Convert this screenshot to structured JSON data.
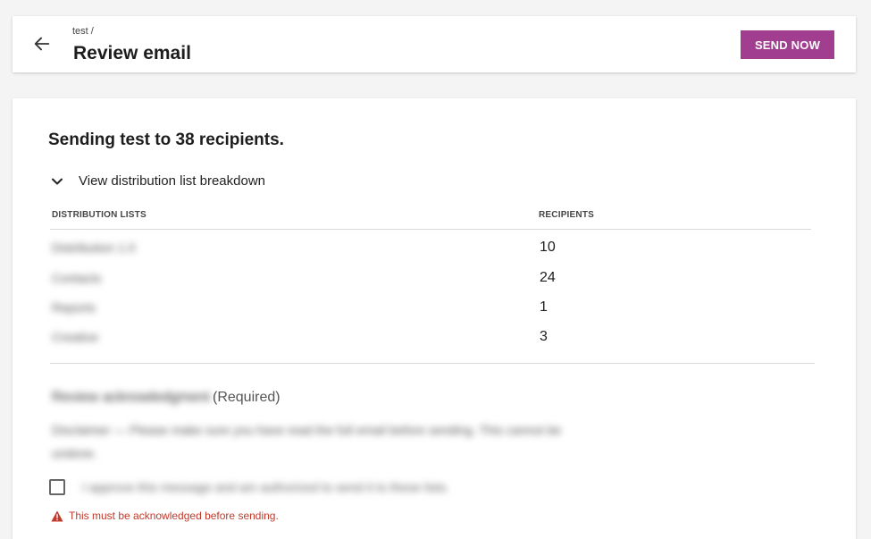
{
  "header": {
    "breadcrumb": "test /",
    "title": "Review email",
    "send_label": "SEND NOW",
    "accent_color": "#a23e90"
  },
  "main": {
    "summary": "Sending test to 38 recipients.",
    "toggle_label": "View distribution list breakdown",
    "columns": {
      "lists": "DISTRIBUTION LISTS",
      "recipients": "RECIPIENTS"
    },
    "rows": [
      {
        "name": "Distribution 1.0",
        "count": "10"
      },
      {
        "name": "Contacts",
        "count": "24"
      },
      {
        "name": "Reports",
        "count": "1"
      },
      {
        "name": "Creative",
        "count": "3"
      }
    ],
    "acknowledgement": {
      "title": "Review acknowledgment",
      "required": "(Required)",
      "body": "Disclaimer — Please make sure you have read the full email before sending. This cannot be undone.",
      "checkbox_label": "I approve this message and am authorized to send it to these lists.",
      "error": "This must be acknowledged before sending."
    }
  }
}
